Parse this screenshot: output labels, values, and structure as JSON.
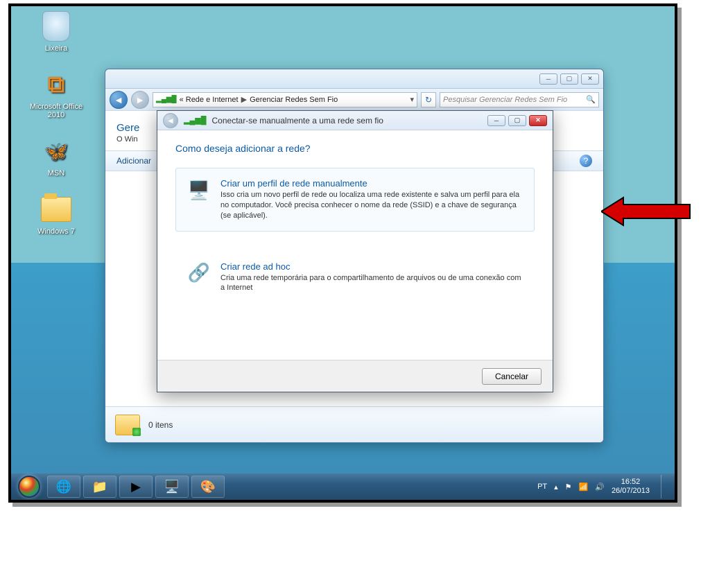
{
  "desktop_icons": {
    "trash": "Lixeira",
    "office": "Microsoft Office 2010",
    "msn": "MSN",
    "folder": "Windows 7"
  },
  "explorer": {
    "breadcrumb_prefix": "«",
    "breadcrumb_1": "Rede e Internet",
    "breadcrumb_2": "Gerenciar Redes Sem Fio",
    "search_placeholder": "Pesquisar Gerenciar Redes Sem Fio",
    "page_title_partial": "Gere",
    "page_sub_partial": "O Win",
    "cmd_add": "Adicionar",
    "status_items": "0 itens"
  },
  "wizard": {
    "title": "Conectar-se manualmente a uma rede sem fio",
    "question": "Como deseja adicionar a rede?",
    "opt1_title": "Criar um perfil de rede manualmente",
    "opt1_desc": "Isso cria um novo perfil de rede ou localiza uma rede existente e salva um perfil para ela no computador. Você precisa conhecer o nome da rede (SSID) e a chave de segurança (se aplicável).",
    "opt2_title": "Criar rede ad hoc",
    "opt2_desc": "Cria uma rede temporária para o compartilhamento de arquivos ou de uma conexão com a Internet",
    "cancel": "Cancelar"
  },
  "taskbar": {
    "lang": "PT",
    "time": "16:52",
    "date": "26/07/2013"
  }
}
